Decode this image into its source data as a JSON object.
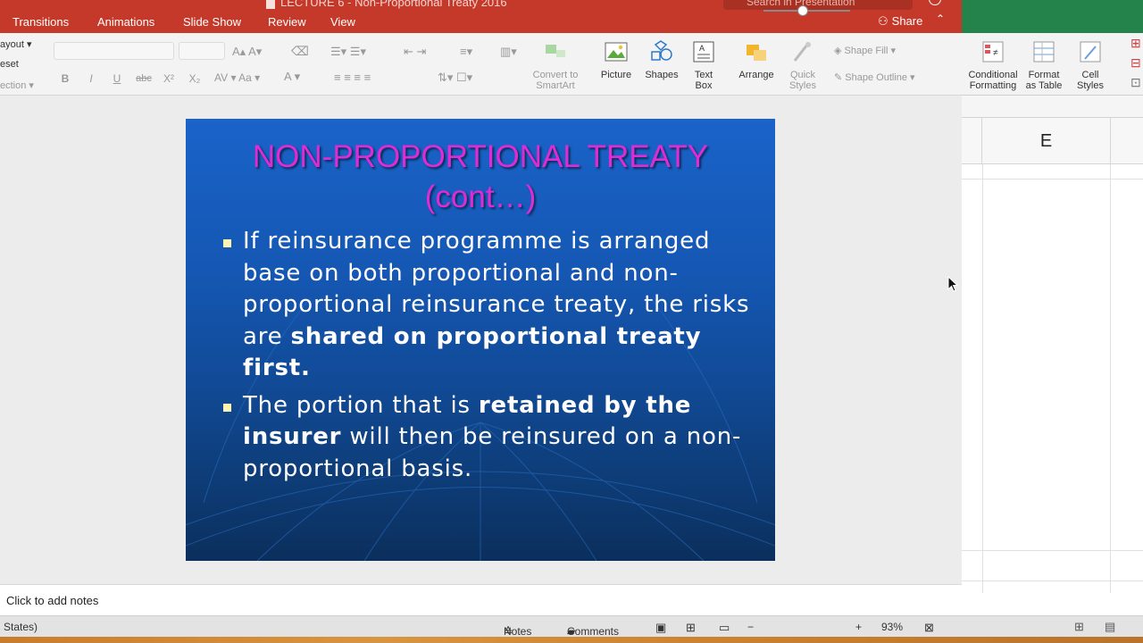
{
  "window": {
    "title": "LECTURE 6 - Non-Proportional Treaty 2016",
    "search_placeholder": "Search in Presentation",
    "share_label": "Share"
  },
  "tabs": [
    "Transitions",
    "Animations",
    "Slide Show",
    "Review",
    "View"
  ],
  "ribbon": {
    "left_labels": [
      "ayout",
      "eset",
      "ection"
    ],
    "convert_label_1": "Convert to",
    "convert_label_2": "SmartArt",
    "picture": "Picture",
    "shapes": "Shapes",
    "textbox_1": "Text",
    "textbox_2": "Box",
    "arrange": "Arrange",
    "quick_styles_1": "Quick",
    "quick_styles_2": "Styles",
    "shape_fill": "Shape Fill",
    "shape_outline": "Shape Outline",
    "format_bold": "B",
    "format_italic": "I",
    "format_underline": "U",
    "format_strike": "abc",
    "format_super": "X²",
    "format_sub": "X₂"
  },
  "slide": {
    "title_line1": "NON-PROPORTIONAL TREATY",
    "title_line2": "(cont…)",
    "bullet1_part1": "If reinsurance programme is arranged base on both proportional and non-proportional reinsurance treaty, the risks are ",
    "bullet1_bold": "shared on proportional treaty first.",
    "bullet2_part1": "The portion that is ",
    "bullet2_bold1": "retained by the insurer",
    "bullet2_part2": " will then be reinsured on a non-proportional basis."
  },
  "notes": {
    "placeholder": "Click to add notes"
  },
  "status": {
    "language": "States)",
    "notes_btn": "Notes",
    "comments_btn": "Comments",
    "zoom": "93%",
    "zoom_minus": "−",
    "zoom_plus": "+"
  },
  "excel": {
    "conditional_1": "Conditional",
    "conditional_2": "Formatting",
    "format_table_1": "Format",
    "format_table_2": "as Table",
    "cell_styles_1": "Cell",
    "cell_styles_2": "Styles",
    "column_header": "E"
  },
  "colors": {
    "ppt_accent": "#c5392a",
    "excel_accent": "#24834a",
    "slide_title": "#e02ad6",
    "bullet_marker": "#fbf6b0"
  }
}
